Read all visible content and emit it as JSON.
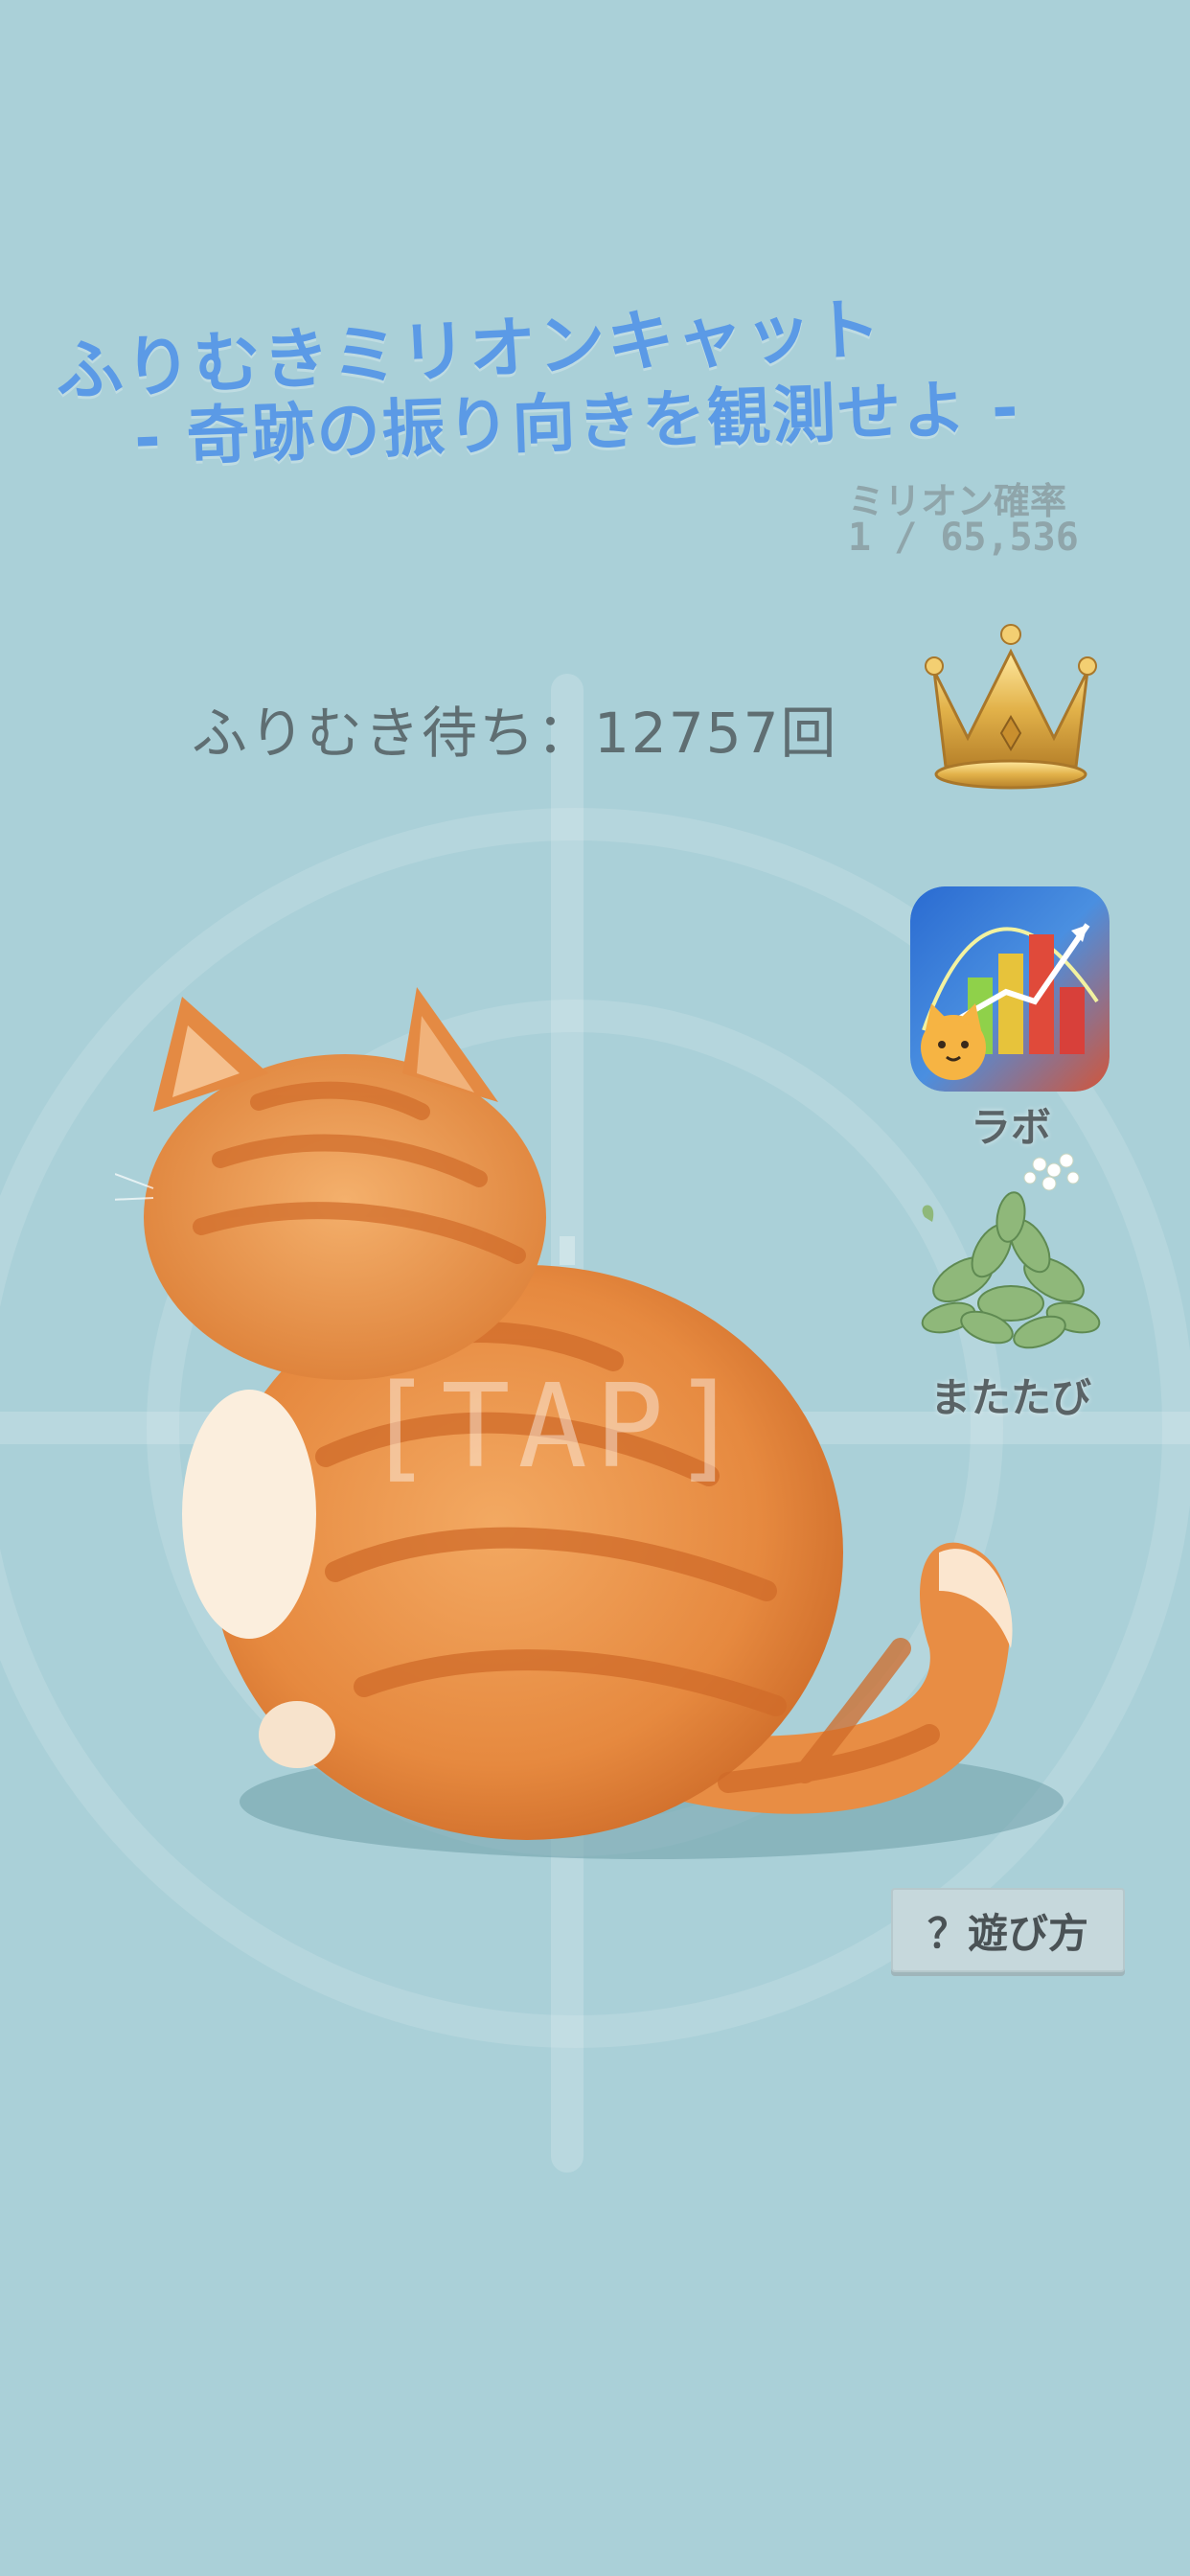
{
  "title": {
    "line1": "ふりむきミリオンキャット",
    "line2": "-  奇跡の振り向きを観測せよ  -"
  },
  "probability": {
    "label": "ミリオン確率",
    "value": "1 / 65,536"
  },
  "counter": {
    "text": "ふりむき待ち：12757回"
  },
  "side_menu": {
    "lab_label": "ラボ",
    "matatabi_label": "またたび"
  },
  "tap_prompt": "[TAP]",
  "howto_label": "？遊び方",
  "icons": {
    "ranking": "crown-icon",
    "lab": "chart-cat-icon",
    "matatabi": "plant-icon"
  },
  "colors": {
    "background": "#aad0d8",
    "title": "#5b9ae6",
    "cat": "#e8904a"
  }
}
